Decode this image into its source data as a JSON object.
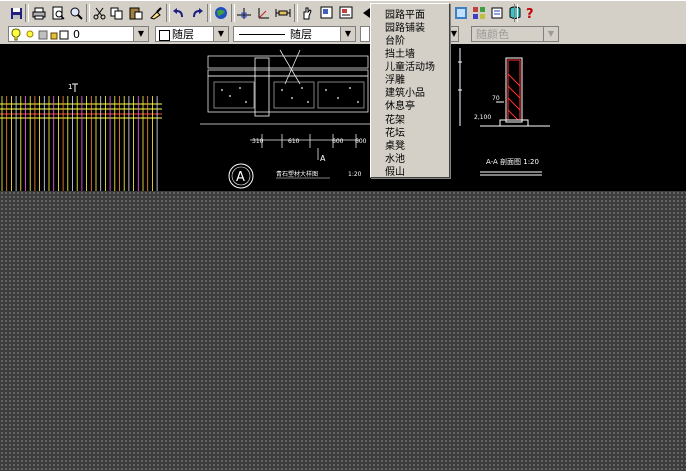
{
  "toolbar": {
    "buttons": [
      {
        "icon": "save-icon"
      },
      {
        "icon": "print-icon"
      },
      {
        "icon": "print-preview-icon"
      },
      {
        "icon": "find-icon"
      },
      {
        "icon": "cut-icon"
      },
      {
        "icon": "copy-icon"
      },
      {
        "icon": "paste-icon"
      },
      {
        "icon": "match-properties-icon"
      },
      {
        "icon": "undo-icon"
      },
      {
        "icon": "redo-icon"
      },
      {
        "icon": "publish-icon"
      },
      {
        "icon": "snap-tracking-icon"
      },
      {
        "icon": "ucs-icon"
      },
      {
        "icon": "distance-icon"
      },
      {
        "icon": "pan-icon"
      },
      {
        "icon": "zoom-window-icon"
      },
      {
        "icon": "properties-icon"
      },
      {
        "icon": "design-center-icon"
      },
      {
        "icon": "tool-palettes-icon"
      },
      {
        "icon": "database-icon"
      },
      {
        "icon": "help-icon"
      }
    ]
  },
  "properties_bar": {
    "layer_value": "0",
    "color_value": "随层",
    "linetype_value": "随层",
    "plotstyle_value": "随颜色"
  },
  "menu": {
    "items": [
      "园路平面",
      "园路铺装",
      "台阶",
      "挡土墙",
      "儿童活动场",
      "浮雕",
      "建筑小品",
      "休息亭",
      "花架",
      "花坛",
      "桌凳",
      "水池",
      "假山"
    ]
  },
  "drawing": {
    "section_mark": "A",
    "title_left": "青石塑材大样图",
    "scale_left": "1:20",
    "title_right": "A-A 剖面图 1:20",
    "label_a": "A",
    "label_1": "1",
    "dims": [
      "310",
      "610",
      "600",
      "600",
      "2,100",
      "70",
      "3,100"
    ],
    "colors": {
      "accent_red": "#ff3030",
      "accent_yellow": "#ffff40",
      "line_white": "#e8e8e8"
    }
  }
}
